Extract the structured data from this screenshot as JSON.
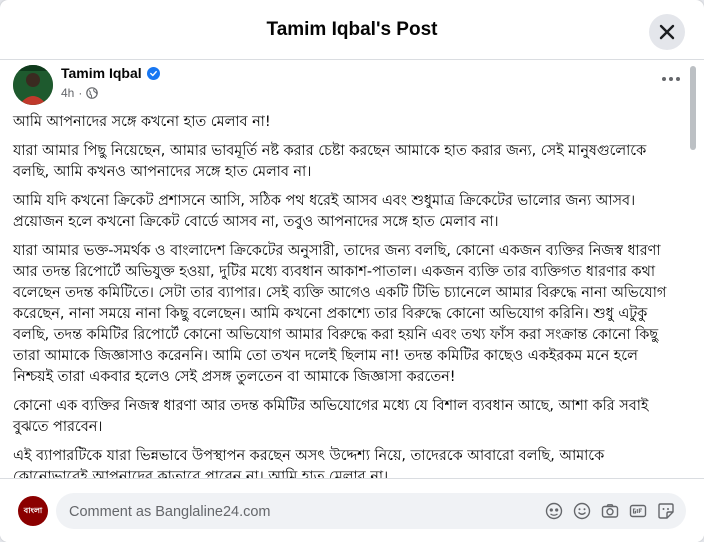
{
  "dialog": {
    "title": "Tamim Iqbal's Post"
  },
  "post": {
    "author": "Tamim Iqbal",
    "time": "4h",
    "paragraphs": [
      "আমি আপনাদের সঙ্গে কখনো হাত মেলাব না!",
      "যারা আমার পিছু নিয়েছেন, আমার ভাবমূর্তি নষ্ট করার চেষ্টা করছেন আমাকে হাত করার জন্য, সেই মানুষগুলোকে বলছি, আমি কখনও আপনাদের সঙ্গে হাত মেলাব না।",
      "আমি যদি কখনো ক্রিকেট প্রশাসনে আসি, সঠিক পথ ধরেই আসব এবং শুধুমাত্র ক্রিকেটের ভালোর জন্য আসব। প্রয়োজন হলে কখনো ক্রিকেট বোর্ডে আসব না, তবুও আপনাদের সঙ্গে হাত মেলাব না।",
      "যারা আমার ভক্ত-সমর্থক ও বাংলাদেশ ক্রিকেটের অনুসারী, তাদের জন্য বলছি, কোনো একজন ব্যক্তির নিজস্ব ধারণা আর তদন্ত রিপোর্টে অভিযুক্ত হওয়া, দুটির মধ্যে ব্যবধান আকাশ-পাতাল। একজন ব্যক্তি তার ব্যক্তিগত ধারণার কথা বলেছেন তদন্ত কমিটিতে। সেটা তার ব্যাপার। সেই ব্যক্তি আগেও একটি টিভি চ্যানেলে আমার বিরুদ্ধে নানা অভিযোগ করেছেন, নানা সময়ে নানা কিছু বলেছেন। আমি কখনো প্রকাশ্যে তার বিরুদ্ধে কোনো অভিযোগ করিনি। শুধু এটুকু বলছি, তদন্ত কমিটির রিপোর্টে কোনো অভিযোগ আমার বিরুদ্ধে করা হয়নি এবং তথ্য ফাঁস করা সংক্রান্ত কোনো কিছু তারা আমাকে জিজ্ঞাসাও করেননি। আমি তো তখন দলেই ছিলাম না! তদন্ত কমিটির কাছেও একইরকম মনে হলে নিশ্চয়ই তারা একবার হলেও সেই প্রসঙ্গ তুলতেন বা আমাকে জিজ্ঞাসা করতেন!",
      "কোনো এক ব্যক্তির নিজস্ব ধারণা আর তদন্ত কমিটির অভিযোগের মধ্যে যে বিশাল ব্যবধান আছে, আশা করি সবাই বুঝতে পারবেন।",
      "এই ব্যাপারটিকে যারা ভিন্নভাবে উপস্থাপন করছেন অসৎ উদ্দেশ্য নিয়ে, তাদেরকে আবারো বলছি, আমাকে কোনোভাবেই আপনাদের কাতারে পাবেন না। আমি হাত মেলাব না।"
    ]
  },
  "comment": {
    "placeholder": "Comment as Banglaline24.com",
    "avatar_text": "বাংলা"
  },
  "colors": {
    "accent": "#1877f2",
    "secondary_text": "#65676b"
  }
}
